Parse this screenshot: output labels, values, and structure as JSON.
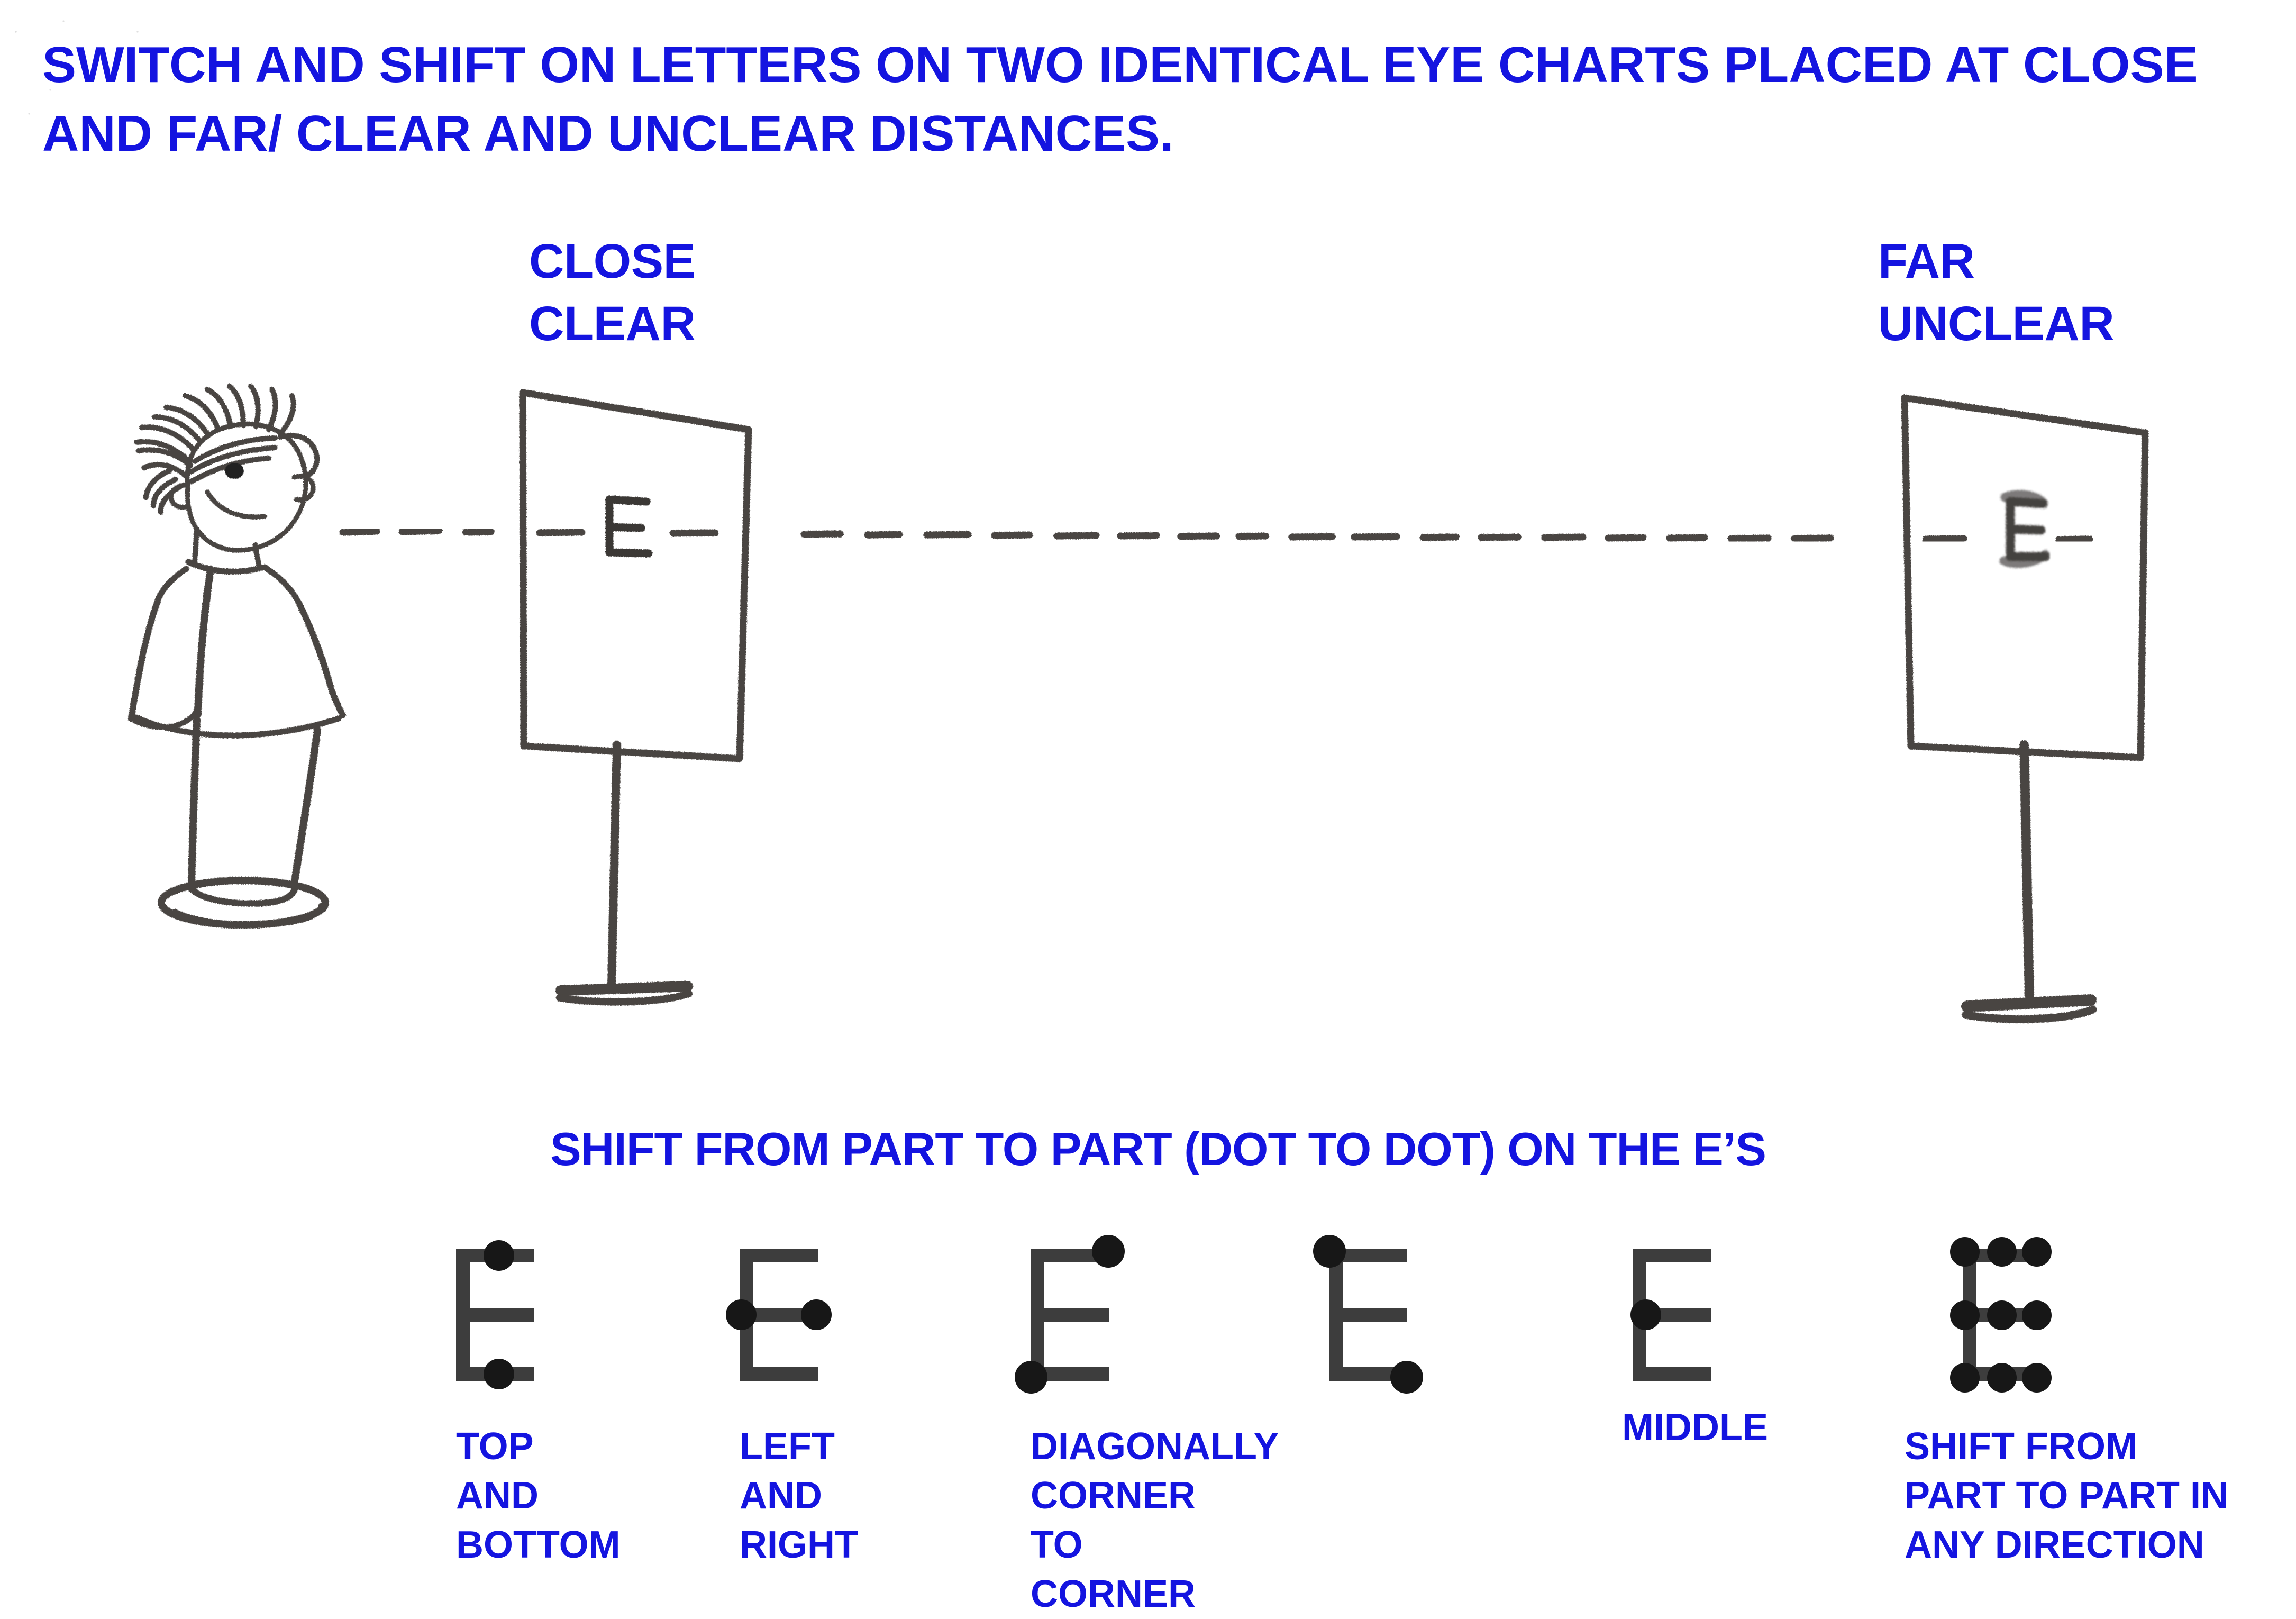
{
  "title": "SWITCH AND SHIFT ON LETTERS ON TWO IDENTICAL EYE CHARTS PLACED AT CLOSE\nAND FAR/ CLEAR AND UNCLEAR DISTANCES.",
  "subtitle": "SHIFT FROM PART TO PART (DOT TO DOT) ON THE E’S",
  "labels": {
    "close": "CLOSE\nCLEAR",
    "far": "FAR\nUNCLEAR"
  },
  "colors": {
    "text_blue": "#1414e0",
    "pencil_gray": "#3d3d3d",
    "dot_black": "#171717",
    "background": "#ffffff"
  },
  "scene": {
    "person": "child-stick-figure-profile-facing-right",
    "close_chart": {
      "letter": "E",
      "clarity": "clear",
      "caption": "CLOSE\nCLEAR"
    },
    "far_chart": {
      "letter": "E",
      "clarity": "unclear",
      "caption": "FAR\nUNCLEAR"
    },
    "sight_line": "dashed-pencil-line-from-eye-through-both-charts"
  },
  "e_examples": [
    {
      "id": "top-and-bottom",
      "caption": "TOP\nAND\nBOTTOM",
      "dots": [
        "top-middle",
        "bottom-middle"
      ]
    },
    {
      "id": "left-and-right",
      "caption": "LEFT\nAND\nRIGHT",
      "dots": [
        "middle-left",
        "middle-right"
      ]
    },
    {
      "id": "diagonally-corner-to-corner",
      "caption": "DIAGONALLY\nCORNER\nTO\nCORNER",
      "dots": [
        "top-right",
        "bottom-left"
      ]
    },
    {
      "id": "diagonally-corner-to-corner-2",
      "caption": "",
      "dots": [
        "top-left",
        "bottom-right"
      ]
    },
    {
      "id": "middle",
      "caption": "MIDDLE",
      "dots": [
        "center"
      ]
    },
    {
      "id": "any-direction",
      "caption": "SHIFT FROM\nPART TO PART IN\nANY DIRECTION",
      "dots": [
        "top-left",
        "top-middle",
        "top-right",
        "middle-left",
        "middle-center",
        "middle-right",
        "bottom-left",
        "bottom-middle",
        "bottom-right"
      ]
    }
  ]
}
